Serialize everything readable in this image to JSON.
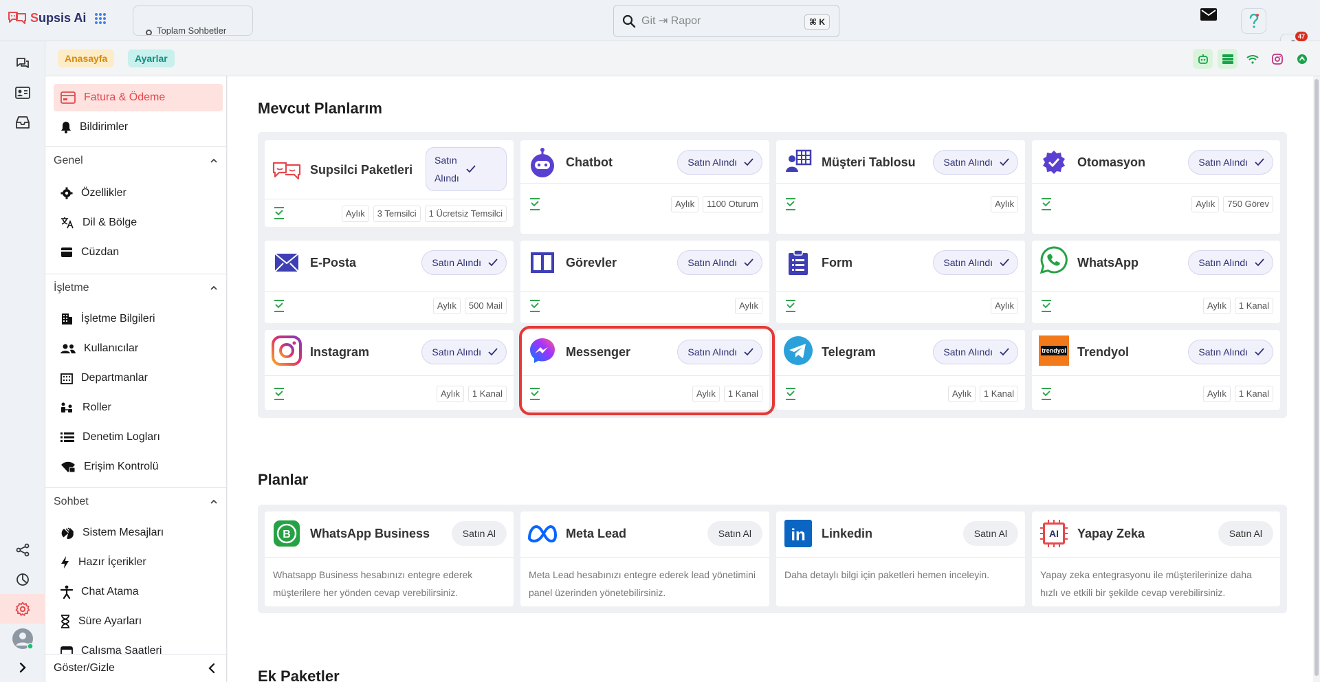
{
  "app": {
    "name_prefix": "S",
    "name_rest": "upsis Ai",
    "total_chats_label": "Toplam Sohbetler",
    "notification_count": "47"
  },
  "search": {
    "placeholder": "Git ⇥ Rapor",
    "shortcut": "⌘ K"
  },
  "breadcrumb": {
    "home": "Anasayfa",
    "current": "Ayarlar"
  },
  "sidebar": {
    "billing": "Fatura & Ödeme",
    "notifications": "Bildirimler",
    "general_title": "Genel",
    "general": [
      "Özellikler",
      "Dil & Bölge",
      "Cüzdan"
    ],
    "business_title": "İşletme",
    "business": [
      "İşletme Bilgileri",
      "Kullanıcılar",
      "Departmanlar",
      "Roller",
      "Denetim Logları",
      "Erişim Kontrolü"
    ],
    "chat_title": "Sohbet",
    "chat": [
      "Sistem Mesajları",
      "Hazır İçerikler",
      "Chat Atama",
      "Süre Ayarları",
      "Çalışma Saatleri"
    ],
    "toggle_label": "Göster/Gizle"
  },
  "my_plans": {
    "title": "Mevcut Planlarım",
    "bought_label": "Satın Alındı",
    "bought_line1": "Satın",
    "bought_line2": "Alındı",
    "cards": [
      {
        "name": "Supsilci Paketleri",
        "icon": "supsis-logo-icon",
        "tags": [
          "Aylık",
          "3 Temsilci",
          "1 Ücretsiz Temsilci"
        ]
      },
      {
        "name": "Chatbot",
        "icon": "robot-icon",
        "tags": [
          "Aylık",
          "1100 Oturum"
        ]
      },
      {
        "name": "Müşteri Tablosu",
        "icon": "customer-table-icon",
        "tags": [
          "Aylık"
        ]
      },
      {
        "name": "Otomasyon",
        "icon": "verified-badge-icon",
        "tags": [
          "Aylık",
          "750 Görev"
        ]
      },
      {
        "name": "E-Posta",
        "icon": "envelope-icon",
        "tags": [
          "Aylık",
          "500 Mail"
        ]
      },
      {
        "name": "Görevler",
        "icon": "board-icon",
        "tags": [
          "Aylık"
        ]
      },
      {
        "name": "Form",
        "icon": "clipboard-icon",
        "tags": [
          "Aylık"
        ]
      },
      {
        "name": "WhatsApp",
        "icon": "whatsapp-icon",
        "tags": [
          "Aylık",
          "1 Kanal"
        ]
      },
      {
        "name": "Instagram",
        "icon": "instagram-icon",
        "tags": [
          "Aylık",
          "1 Kanal"
        ]
      },
      {
        "name": "Messenger",
        "icon": "messenger-icon",
        "tags": [
          "Aylık",
          "1 Kanal"
        ]
      },
      {
        "name": "Telegram",
        "icon": "telegram-icon",
        "tags": [
          "Aylık",
          "1 Kanal"
        ]
      },
      {
        "name": "Trendyol",
        "icon": "trendyol-logo-icon",
        "logo_text": "trendyol",
        "tags": [
          "Aylık",
          "1 Kanal"
        ]
      }
    ]
  },
  "plans": {
    "title": "Planlar",
    "buy_label": "Satın Al",
    "cards": [
      {
        "name": "WhatsApp Business",
        "icon": "whatsapp-business-icon",
        "desc": "Whatsapp Business hesabınızı entegre ederek müşterilere her yönden cevap verebilirsiniz."
      },
      {
        "name": "Meta Lead",
        "icon": "meta-icon",
        "desc": "Meta Lead hesabınızı entegre ederek lead yönetimini panel üzerinden yönetebilirsiniz."
      },
      {
        "name": "Linkedin",
        "icon": "linkedin-icon",
        "logo_text": "in",
        "desc": "Daha detaylı bilgi için paketleri hemen inceleyin."
      },
      {
        "name": "Yapay Zeka",
        "icon": "ai-chip-icon",
        "logo_text": "AI",
        "desc": "Yapay zeka entegrasyonu ile müşterilerinize daha hızlı ve etkili bir şekilde cevap verebilirsiniz."
      }
    ]
  },
  "extras": {
    "title": "Ek Paketler"
  },
  "colors": {
    "accent": "#e5484d",
    "brand_navy": "#2b2f6b",
    "highlight": "#e53935",
    "check_green": "#2fa84f",
    "bought_text": "#2e2f75"
  }
}
